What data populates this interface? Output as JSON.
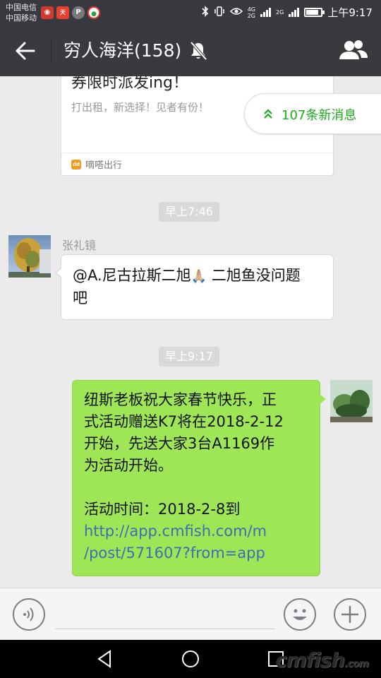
{
  "status_bar": {
    "carrier_1": "中国电信",
    "carrier_2": "中国移动",
    "network_1": "4G",
    "network_2": "2G",
    "network_3": "2G",
    "time": "上午9:17"
  },
  "header": {
    "title": "穷人海洋(158)",
    "muted": true
  },
  "chat": {
    "link_card": {
      "title": "券限时派发ing！",
      "description": "打出租，新选择！见者有份！",
      "source": "嘀嗒出行"
    },
    "new_messages": "107条新消息",
    "timestamp_1": "早上7:46",
    "message_1": {
      "sender": "张礼镜",
      "line_1_a": "@A.尼古拉斯二旭",
      "line_1_emoji": "🙏🏼",
      "line_1_b": " 二旭鱼没问题",
      "line_2": "吧"
    },
    "timestamp_2": "早上9:17",
    "message_2": {
      "line_1": "纽斯老板祝大家春节快乐，正",
      "line_2": "式活动赠送K7将在2018-2-12",
      "line_3": "开始，先送大家3台A1169作",
      "line_4": "为活动开始。",
      "line_5": "活动时间：2018-2-8到",
      "link_1": "http://app.cmfish.com/m",
      "link_2": "/post/571607?from=app"
    }
  },
  "input_bar": {
    "value": ""
  },
  "watermark": {
    "text": "cmfish",
    "suffix": ".com"
  },
  "colors": {
    "header_bg": "#393a3f",
    "chat_bg": "#ebebeb",
    "outgoing_bubble": "#9fe657",
    "accent_green": "#1aad19",
    "link": "#3a6fb3"
  }
}
